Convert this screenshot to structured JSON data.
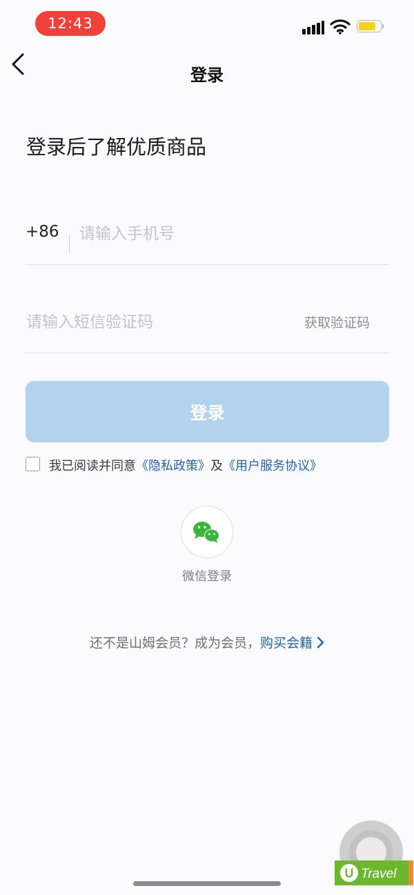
{
  "status_bar": {
    "time": "12:43",
    "battery_color": "#f4d21e",
    "time_pill_color": "#f0413a"
  },
  "nav": {
    "title": "登录",
    "back_icon": "chevron-left-icon"
  },
  "headline": "登录后了解优质商品",
  "phone": {
    "country_code": "+86",
    "placeholder": "请输入手机号"
  },
  "sms": {
    "placeholder": "请输入短信验证码",
    "get_code_label": "获取验证码"
  },
  "login_button": {
    "label": "登录",
    "color": "#b2d3eb"
  },
  "agreement": {
    "prefix": "我已阅读并同意",
    "privacy_link": "《隐私政策》",
    "conjunction": "及",
    "terms_link": "《用户服务协议》",
    "link_color": "#1f64ad"
  },
  "wechat": {
    "label": "微信登录",
    "icon": "wechat-icon",
    "icon_color": "#3bb53b"
  },
  "member": {
    "prompt": "还不是山姆会员？成为会员，",
    "buy_link": "购买会籍"
  },
  "watermark": {
    "text": "Travel",
    "logo_text": "U"
  }
}
